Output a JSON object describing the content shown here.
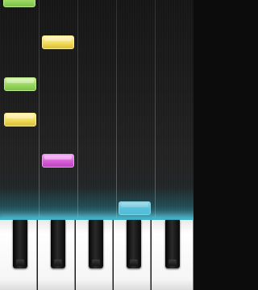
{
  "game": {
    "board": {
      "lane_count": 5,
      "background_color": "#1d1d1d",
      "hit_line_color": "#3fb2c8"
    },
    "notes": [
      {
        "lane": 1,
        "color_name": "green",
        "color": "#99d860"
      },
      {
        "lane": 2,
        "color_name": "yellow",
        "color": "#f2dc5a"
      },
      {
        "lane": 1,
        "color_name": "green",
        "color": "#99d860"
      },
      {
        "lane": 1,
        "color_name": "yellow",
        "color": "#f2dc5a"
      },
      {
        "lane": 2,
        "color_name": "magenta",
        "color": "#d65fd8"
      },
      {
        "lane": 4,
        "color_name": "cyan",
        "color": "#6ccbe7"
      }
    ],
    "keyboard": {
      "white_key_count": 5,
      "black_key_count": 5,
      "white_key_color": "#ffffff",
      "black_key_color": "#111111"
    }
  }
}
